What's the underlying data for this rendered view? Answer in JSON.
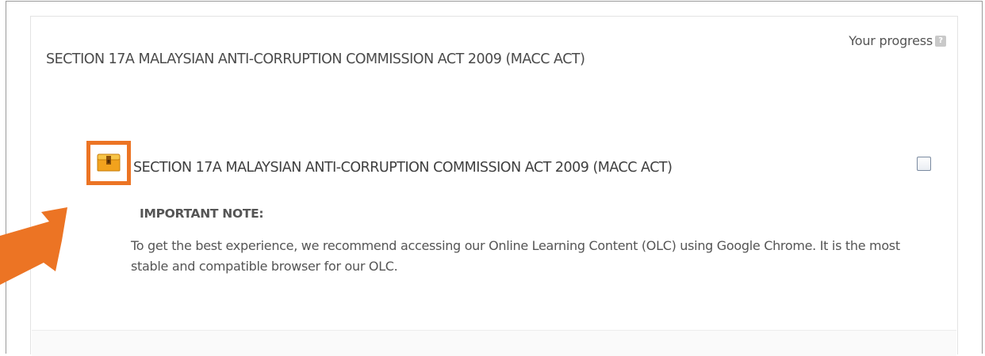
{
  "progress": {
    "label": "Your progress",
    "help_glyph": "?"
  },
  "section": {
    "title": "SECTION 17A MALAYSIAN ANTI-CORRUPTION COMMISSION ACT 2009 (MACC ACT)"
  },
  "activity": {
    "icon": "treasure-chest-icon",
    "title": "SECTION 17A MALAYSIAN ANTI-CORRUPTION COMMISSION ACT 2009 (MACC ACT)",
    "completed": false,
    "note_label": "IMPORTANT NOTE:",
    "note_body": "To get the best experience, we recommend accessing our Online Learning Content (OLC) using Google Chrome.  It is the most stable and compatible browser for our OLC."
  },
  "annotation": {
    "arrow_color": "#ec7424",
    "highlight_color": "#ec7424"
  }
}
